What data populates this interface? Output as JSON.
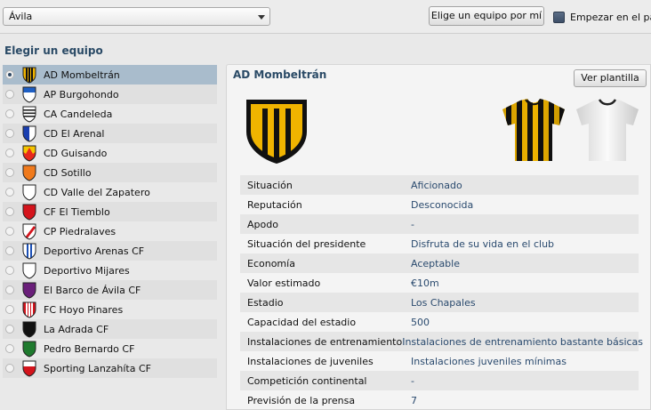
{
  "topbar": {
    "region_value": "Ávila",
    "pick_button_label": "Elige un equipo por mí",
    "start_label": "Empezar en el parc"
  },
  "left": {
    "title": "Elegir un equipo",
    "teams": [
      {
        "name": "AD Mombeltrán",
        "selected": true,
        "crest_colors": [
          "#f0b400",
          "#111111"
        ],
        "crest_pattern": "stripes"
      },
      {
        "name": "AP Burgohondo",
        "selected": false,
        "crest_colors": [
          "#1e5fc4",
          "#ffffff"
        ],
        "crest_pattern": "top"
      },
      {
        "name": "CA Candeleda",
        "selected": false,
        "crest_colors": [
          "#ffffff",
          "#222222"
        ],
        "crest_pattern": "hstripes"
      },
      {
        "name": "CD El Arenal",
        "selected": false,
        "crest_colors": [
          "#1a3fb0",
          "#ffffff"
        ],
        "crest_pattern": "half"
      },
      {
        "name": "CD Guisando",
        "selected": false,
        "crest_colors": [
          "#e8291c",
          "#f5c400"
        ],
        "crest_pattern": "fire"
      },
      {
        "name": "CD Sotillo",
        "selected": false,
        "crest_colors": [
          "#f07a1c",
          "#f07a1c"
        ],
        "crest_pattern": "solid"
      },
      {
        "name": "CD Valle del Zapatero",
        "selected": false,
        "crest_colors": [
          "#ffffff",
          "#ffffff"
        ],
        "crest_pattern": "solid"
      },
      {
        "name": "CF El Tiemblo",
        "selected": false,
        "crest_colors": [
          "#d4141c",
          "#d4141c"
        ],
        "crest_pattern": "solid"
      },
      {
        "name": "CP Piedralaves",
        "selected": false,
        "crest_colors": [
          "#ffffff",
          "#d4141c"
        ],
        "crest_pattern": "diag"
      },
      {
        "name": "Deportivo Arenas CF",
        "selected": false,
        "crest_colors": [
          "#ffffff",
          "#1a4fb5"
        ],
        "crest_pattern": "vstripes"
      },
      {
        "name": "Deportivo Mijares",
        "selected": false,
        "crest_colors": [
          "#ffffff",
          "#ffffff"
        ],
        "crest_pattern": "solid"
      },
      {
        "name": "El Barco de Ávila CF",
        "selected": false,
        "crest_colors": [
          "#6a1f7a",
          "#6a1f7a"
        ],
        "crest_pattern": "solid"
      },
      {
        "name": "FC Hoyo Pinares",
        "selected": false,
        "crest_colors": [
          "#d4141c",
          "#ffffff"
        ],
        "crest_pattern": "stripes"
      },
      {
        "name": "La Adrada CF",
        "selected": false,
        "crest_colors": [
          "#111111",
          "#111111"
        ],
        "crest_pattern": "solid"
      },
      {
        "name": "Pedro Bernardo CF",
        "selected": false,
        "crest_colors": [
          "#1f7a2e",
          "#1f7a2e"
        ],
        "crest_pattern": "solid"
      },
      {
        "name": "Sporting Lanzahíta CF",
        "selected": false,
        "crest_colors": [
          "#ffffff",
          "#d4141c"
        ],
        "crest_pattern": "top"
      }
    ]
  },
  "detail": {
    "title": "AD Mombeltrán",
    "squad_button_label": "Ver plantilla",
    "home_kit_colors": [
      "#f0b400",
      "#111111"
    ],
    "away_kit_colors": [
      "#ffffff",
      "#222222"
    ],
    "rows": [
      {
        "label": "Situación",
        "value": "Aficionado"
      },
      {
        "label": "Reputación",
        "value": "Desconocida"
      },
      {
        "label": "Apodo",
        "value": "-"
      },
      {
        "label": "Situación del presidente",
        "value": "Disfruta de su vida en el club"
      },
      {
        "label": "Economía",
        "value": "Aceptable"
      },
      {
        "label": "Valor estimado",
        "value": "€10m"
      },
      {
        "label": "Estadio",
        "value": "Los Chapales"
      },
      {
        "label": "Capacidad del estadio",
        "value": "500"
      },
      {
        "label": "Instalaciones de entrenamiento",
        "value": "Instalaciones de entrenamiento bastante básicas"
      },
      {
        "label": "Instalaciones de juveniles",
        "value": "Instalaciones juveniles mínimas"
      },
      {
        "label": "Competición continental",
        "value": "-"
      },
      {
        "label": "Previsión de la prensa",
        "value": "7"
      }
    ]
  }
}
